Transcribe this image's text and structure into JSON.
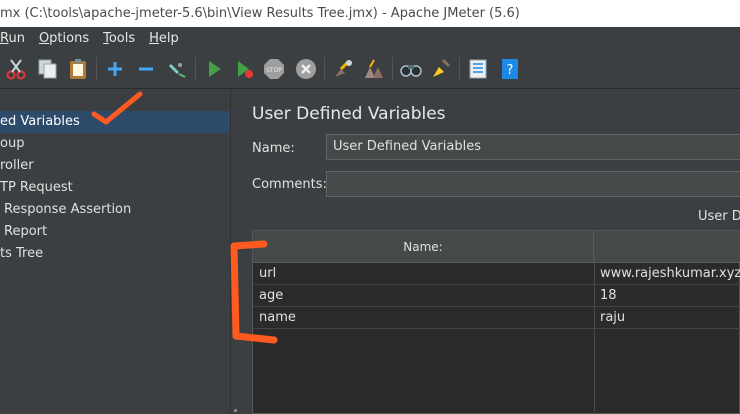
{
  "window": {
    "title": "mx (C:\\tools\\apache-jmeter-5.6\\bin\\View Results Tree.jmx) - Apache JMeter (5.6)"
  },
  "menu": [
    {
      "label": "Run",
      "mnemonic": "R"
    },
    {
      "label": "Options",
      "mnemonic": "O"
    },
    {
      "label": "Tools",
      "mnemonic": "T"
    },
    {
      "label": "Help",
      "mnemonic": "H"
    }
  ],
  "toolbar": {
    "icons": [
      "cut-icon",
      "copy-icon",
      "paste-icon",
      "expand-icon",
      "collapse-icon",
      "toggle-icon",
      "start-icon",
      "start-no-pauses-icon",
      "stop-icon",
      "shutdown-icon",
      "clear-icon",
      "clear-all-icon",
      "search-icon",
      "reset-search-icon",
      "function-helper-icon",
      "help-icon"
    ]
  },
  "tree": {
    "items": [
      {
        "label": "ed Variables",
        "selected": true
      },
      {
        "label": "oup",
        "selected": false
      },
      {
        "label": "roller",
        "selected": false
      },
      {
        "label": "TP Request",
        "selected": false
      },
      {
        "label": "Response Assertion",
        "selected": false
      },
      {
        "label": "Report",
        "selected": false
      },
      {
        "label": "ts Tree",
        "selected": false
      }
    ]
  },
  "panel": {
    "title": "User Defined Variables",
    "name_label": "Name:",
    "name_value": "User Defined Variables",
    "comments_label": "Comments:",
    "comments_value": "",
    "section_label": "User De"
  },
  "table": {
    "headers": [
      "Name:",
      ""
    ],
    "rows": [
      {
        "name": "url",
        "value": "www.rajeshkumar.xyz"
      },
      {
        "name": "age",
        "value": "18"
      },
      {
        "name": "name",
        "value": "raju"
      }
    ]
  },
  "colors": {
    "background": "#3c3f41",
    "selection": "#2d4a6a",
    "annotation": "#ff5a1f"
  }
}
